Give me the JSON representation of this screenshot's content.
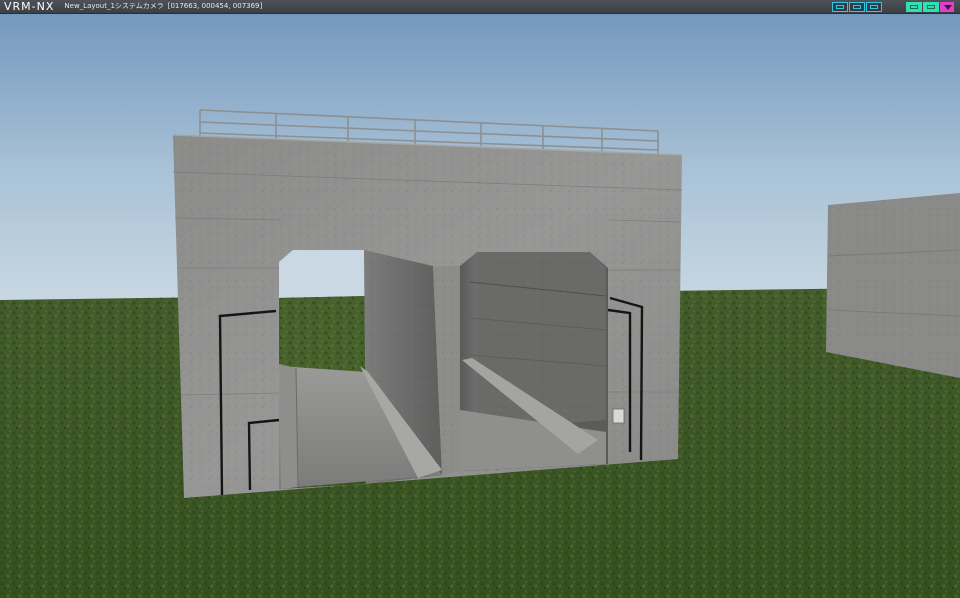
{
  "app": {
    "logo": "VRM-NX",
    "title": "New_Layout_1システムカメラ",
    "coordinates": "[017663, 000454, 007369]"
  },
  "toolbar": {
    "left_group_icons": [
      "view-mode-icon",
      "view-split-icon",
      "view-single-icon"
    ],
    "right_group_icons": [
      "minimize-icon",
      "restore-icon",
      "menu-dropdown-icon"
    ],
    "accent_cyan": "#2ec9e0",
    "accent_green": "#2fe0b2",
    "accent_magenta": "#e040c8"
  },
  "scene": {
    "sky_top": "#6f95bd",
    "sky_horizon": "#c9d8e2",
    "grass": "#3f5a26",
    "concrete": "#8d8d8c"
  }
}
